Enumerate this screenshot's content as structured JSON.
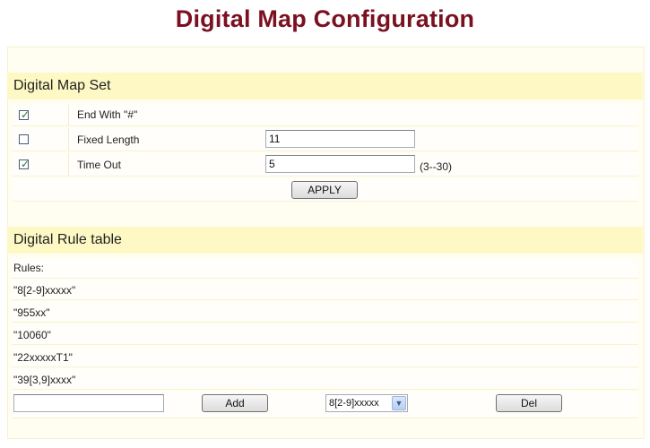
{
  "page": {
    "title": "Digital Map Configuration"
  },
  "digital_map_set": {
    "header": "Digital Map Set",
    "end_with": {
      "label": "End With \"#\"",
      "checked": true
    },
    "fixed_length": {
      "label": "Fixed Length",
      "checked": false,
      "value": "11"
    },
    "time_out": {
      "label": "Time Out",
      "checked": true,
      "value": "5",
      "range_hint": "(3--30)"
    },
    "apply_label": "APPLY"
  },
  "digital_rule_table": {
    "header": "Digital Rule table",
    "rules_label": "Rules:",
    "rules": [
      "\"8[2-9]xxxxx\"",
      "\"955xx\"",
      "\"10060\"",
      "\"22xxxxxT1\"",
      "\"39[3,9]xxxx\""
    ],
    "new_rule_value": "",
    "add_label": "Add",
    "selected_rule": "8[2-9]xxxxx",
    "del_label": "Del"
  },
  "colors": {
    "title": "#7a1020",
    "section_header_bg": "#fdf8c4",
    "panel_bg": "#fffef0",
    "check_tick": "#2a7a2a"
  },
  "icons": {
    "checkbox_checked": "check-icon",
    "select_arrow": "chevron-down-icon"
  }
}
